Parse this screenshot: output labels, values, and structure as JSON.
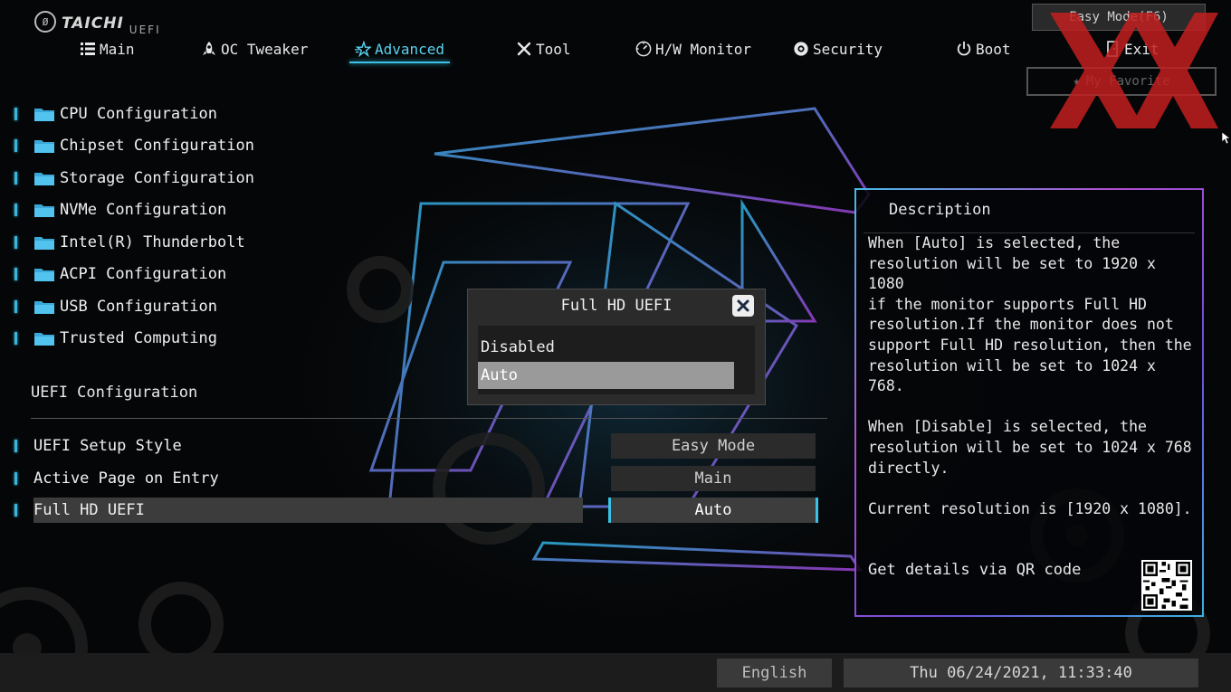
{
  "header": {
    "logo_text": "TAICHI",
    "logo_sub": "UEFI",
    "easy_mode_label": "Easy Mode(F6)",
    "my_favorite_label": "My Favorite"
  },
  "tabs": [
    {
      "label": "Main",
      "icon": "list-icon"
    },
    {
      "label": "OC Tweaker",
      "icon": "rocket-icon"
    },
    {
      "label": "Advanced",
      "icon": "star-icon",
      "active": true
    },
    {
      "label": "Tool",
      "icon": "tools-icon"
    },
    {
      "label": "H/W Monitor",
      "icon": "monitor-icon"
    },
    {
      "label": "Security",
      "icon": "shield-icon"
    },
    {
      "label": "Boot",
      "icon": "power-icon"
    },
    {
      "label": "Exit",
      "icon": "exit-icon"
    }
  ],
  "menu": [
    "CPU Configuration",
    "Chipset Configuration",
    "Storage Configuration",
    "NVMe Configuration",
    "Intel(R) Thunderbolt",
    "ACPI Configuration",
    "USB Configuration",
    "Trusted Computing"
  ],
  "uefi_section": {
    "title": "UEFI Configuration",
    "settings": [
      {
        "label": "UEFI Setup Style",
        "value": "Easy Mode"
      },
      {
        "label": "Active Page on Entry",
        "value": "Main"
      },
      {
        "label": "Full HD UEFI",
        "value": "Auto",
        "selected": true
      }
    ]
  },
  "popup": {
    "title": "Full HD UEFI",
    "options": [
      "Disabled",
      "Auto"
    ],
    "selected": "Auto"
  },
  "description": {
    "title": "Description",
    "body": "When [Auto] is selected, the\nresolution will be set to 1920 x 1080\nif the monitor supports Full HD\nresolution.If the monitor does not\nsupport Full HD resolution, then the\nresolution will be set to 1024 x 768.\n\nWhen [Disable] is selected, the\nresolution will be set to 1024 x 768\ndirectly.\n\nCurrent resolution is [1920 x 1080].",
    "qr_label": "Get details via QR code"
  },
  "footer": {
    "language": "English",
    "datetime": "Thu 06/24/2021, 11:33:40"
  },
  "colors": {
    "accent": "#39c2e6",
    "watermark": "#c21f1f"
  }
}
